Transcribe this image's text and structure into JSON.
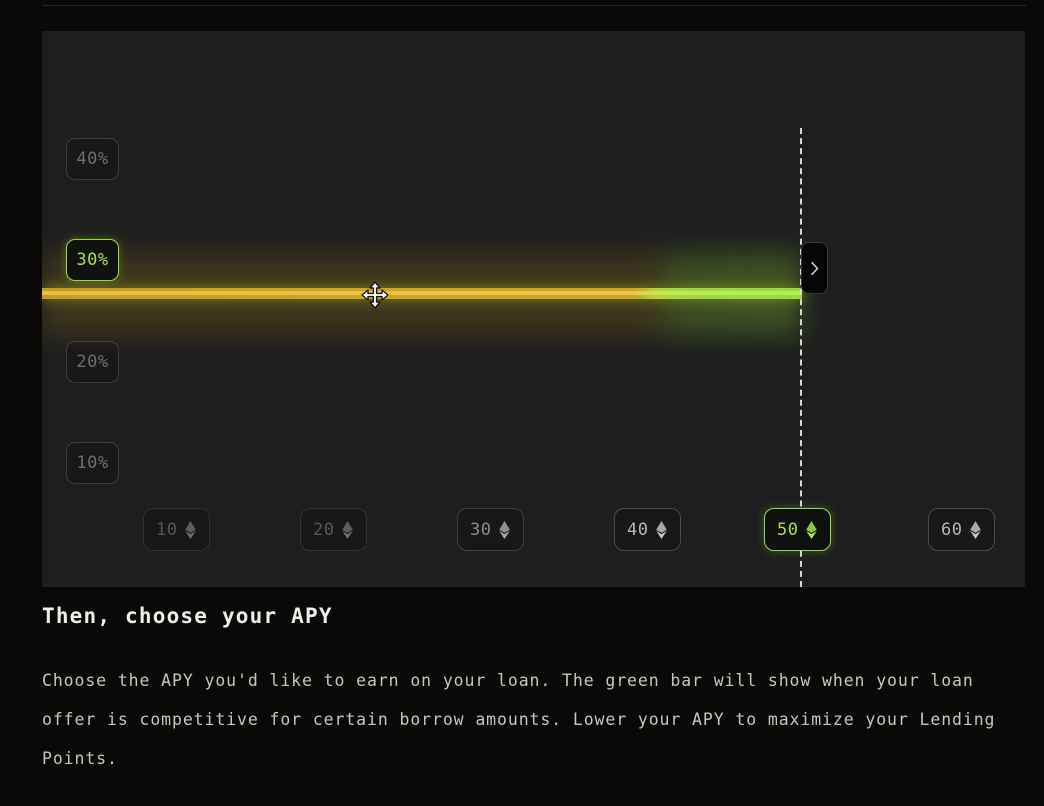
{
  "panel": {
    "y_axis": [
      {
        "label": "40%",
        "active": false
      },
      {
        "label": "30%",
        "active": true
      },
      {
        "label": "20%",
        "active": false
      },
      {
        "label": "10%",
        "active": false
      }
    ],
    "x_axis": [
      {
        "label": "10",
        "icon": "eth-icon",
        "active": false
      },
      {
        "label": "20",
        "icon": "eth-icon",
        "active": false
      },
      {
        "label": "30",
        "icon": "eth-icon",
        "active": false
      },
      {
        "label": "40",
        "icon": "eth-icon",
        "active": false
      },
      {
        "label": "50",
        "icon": "eth-icon",
        "active": true
      },
      {
        "label": "60",
        "icon": "eth-icon",
        "active": false
      }
    ],
    "selected_apy": "30%",
    "selected_amount": "50",
    "next_button_label": "›",
    "drag_cursor": "move-cursor",
    "colors": {
      "accent_green": "#9bd942",
      "bar_yellow": "#d2a520",
      "bar_green": "#96de3f",
      "panel_bg": "#1e1e1e",
      "page_bg": "#0a0908"
    }
  },
  "copy": {
    "heading": "Then, choose your APY",
    "body": "Choose the APY you'd like to earn on your loan. The green bar will show when your loan offer is competitive for certain borrow amounts. Lower your APY to maximize your Lending Points."
  }
}
